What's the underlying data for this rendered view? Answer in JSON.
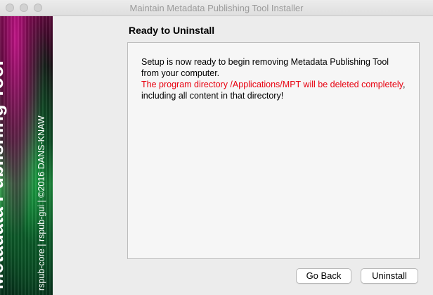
{
  "window": {
    "title": "Maintain Metadata Publishing Tool Installer"
  },
  "banner": {
    "title": "Metadata Publishing Tool",
    "subtitle": "rspub-core | rspub-gui | ©2016 DANS-KNAW"
  },
  "page": {
    "heading": "Ready to Uninstall",
    "message_part1": "Setup is now ready to begin removing Metadata Publishing Tool from your computer.",
    "message_warning": "The program directory /Applications/MPT will be deleted completely",
    "message_part2": ", including all content in that directory!",
    "warning_color": "#e8000f"
  },
  "buttons": {
    "back_label": "Go Back",
    "uninstall_label": "Uninstall"
  }
}
